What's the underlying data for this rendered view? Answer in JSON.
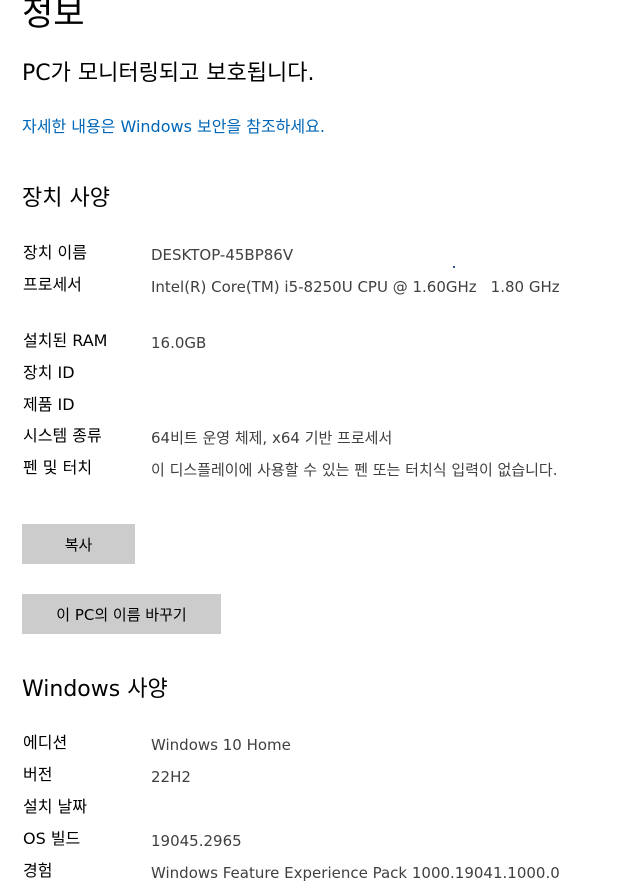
{
  "page": {
    "title": "정보",
    "protection_status": "PC가 모니터링되고 보호됩니다.",
    "details_link": "자세한 내용은 Windows 보안을 참조하세요."
  },
  "device_specs": {
    "heading": "장치 사양",
    "rows": [
      {
        "label": "장치 이름",
        "value": "DESKTOP-45BP86V"
      },
      {
        "label": "프로세서",
        "value_main": "Intel(R) Core(TM) i5-8250U CPU @ 1.60GHz",
        "value_tail": "1.80 GHz"
      },
      {
        "label": "설치된 RAM",
        "value": "16.0GB"
      },
      {
        "label": "장치 ID",
        "value": ""
      },
      {
        "label": "제품 ID",
        "value": ""
      },
      {
        "label": "시스템 종류",
        "value": "64비트 운영 체제, x64 기반 프로세서"
      },
      {
        "label": "펜 및 터치",
        "value": "이 디스플레이에 사용할 수 있는 펜 또는 터치식 입력이 없습니다."
      }
    ],
    "copy_button": "복사",
    "rename_button": "이 PC의 이름 바꾸기"
  },
  "windows_specs": {
    "heading": "Windows 사양",
    "rows": [
      {
        "label": "에디션",
        "value": "Windows 10 Home"
      },
      {
        "label": "버전",
        "value": "22H2"
      },
      {
        "label": "설치 날짜",
        "value": ""
      },
      {
        "label": "OS 빌드",
        "value": "19045.2965"
      },
      {
        "label": "경험",
        "value": "Windows Feature Experience Pack 1000.19041.1000.0"
      }
    ]
  },
  "colors": {
    "link": "#0067b8",
    "value_text": "#404040",
    "button_bg": "#cccccc"
  }
}
